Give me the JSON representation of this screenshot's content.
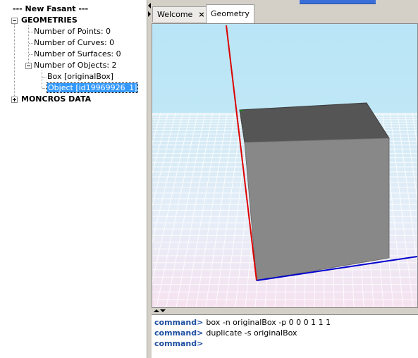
{
  "tree": {
    "root_label": "--- New Fasant ---",
    "geometries_label": "GEOMETRIES",
    "children": [
      {
        "label": "Number of Points: 0"
      },
      {
        "label": "Number of Curves: 0"
      },
      {
        "label": "Number of Surfaces: 0"
      },
      {
        "label": "Number of Objects: 2"
      }
    ],
    "objects": [
      {
        "label": "Box [originalBox]"
      },
      {
        "label": "Object [id19969926_1]"
      }
    ],
    "moncros_label": "MONCROS DATA"
  },
  "tabs": [
    {
      "label": "Welcome",
      "close_glyph": "×"
    },
    {
      "label": "Geometry"
    }
  ],
  "console": {
    "prompt": "command>",
    "lines": [
      {
        "text": "box -n originalBox -p 0 0 0 1 1 1"
      },
      {
        "text": "duplicate -s originalBox"
      },
      {
        "text": ""
      }
    ]
  },
  "colors": {
    "selection": "#3399ff",
    "prompt": "#1e4fa0",
    "axis_x": "#0000cc",
    "axis_z": "#dd0000",
    "box_top": "#555555",
    "box_front": "#888888"
  }
}
